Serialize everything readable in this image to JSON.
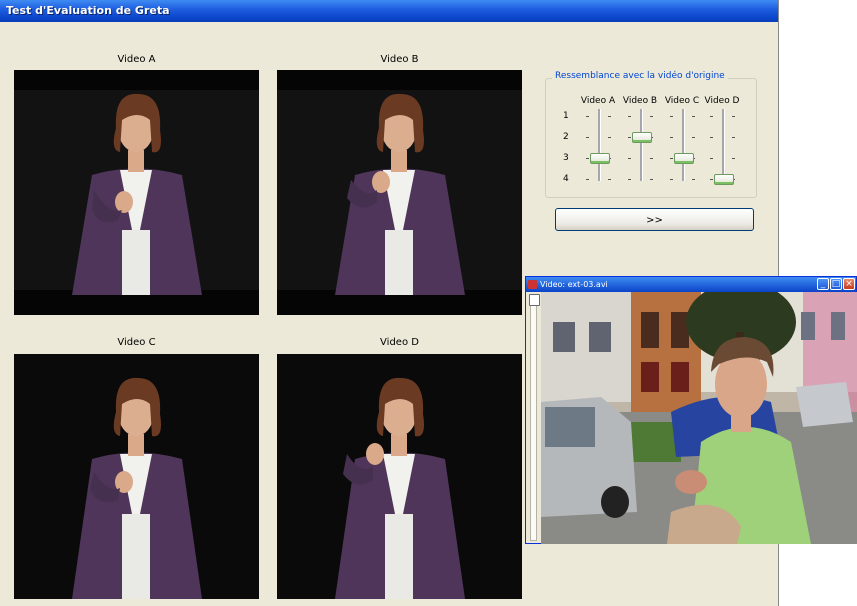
{
  "main_window": {
    "title": "Test d'Evaluation de Greta"
  },
  "videos": [
    {
      "label": "Video A"
    },
    {
      "label": "Video B"
    },
    {
      "label": "Video C"
    },
    {
      "label": "Video D"
    }
  ],
  "rating": {
    "legend": "Ressemblance avec la vidéo d'origine",
    "columns": [
      "Video A",
      "Video B",
      "Video C",
      "Video D"
    ],
    "rows": [
      "1",
      "2",
      "3",
      "4"
    ],
    "values": {
      "video_a": 3,
      "video_b": 2,
      "video_c": 3,
      "video_d": 4
    },
    "next_label": ">>"
  },
  "player": {
    "title": "Video: ext-03.avi",
    "min_glyph": "_",
    "max_glyph": "□",
    "close_glyph": "×",
    "seek_position": 0
  },
  "colors": {
    "titlebar": "#0a43c8",
    "window_bg": "#ece9d8",
    "slider_accent": "#79c063",
    "cardigan": "#4e3559"
  }
}
